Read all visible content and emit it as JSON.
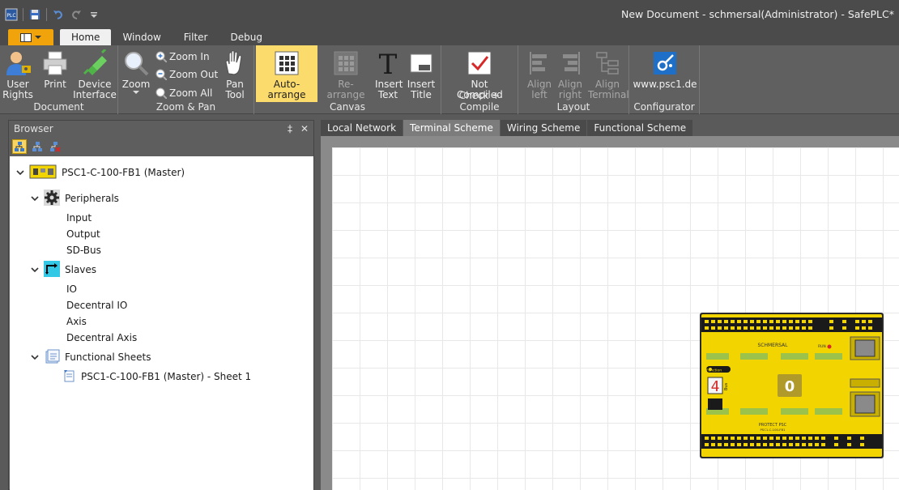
{
  "window": {
    "title": "New Document - schmersal(Administrator) - SafePLC*"
  },
  "quick_access": {
    "icons": [
      "app-logo-icon",
      "save-icon",
      "undo-icon",
      "redo-icon",
      "dropdown-icon"
    ]
  },
  "ribbon_tabs": [
    {
      "label": "Home"
    },
    {
      "label": "Window"
    },
    {
      "label": "Filter"
    },
    {
      "label": "Debug"
    }
  ],
  "ribbon": {
    "groups": {
      "document": "Document",
      "zoom_pan": "Zoom & Pan",
      "canvas": "Canvas",
      "check": "Check + Compile",
      "layout": "Layout",
      "configurator": "Configurator"
    },
    "buttons": {
      "user_rights": "User Rights",
      "print": "Print",
      "device_interface": "Device Interface",
      "zoom": "Zoom",
      "zoom_in": "Zoom In",
      "zoom_out": "Zoom Out",
      "zoom_all": "Zoom All",
      "pan_tool": "Pan Tool",
      "auto_arrange": "Auto-arrange",
      "re_arrange": "Re-arrange",
      "insert_text": "Insert Text",
      "insert_title": "Insert Title",
      "not_compiled": "Not Compiled",
      "align_left": "Align left",
      "align_right": "Align right",
      "align_terminal": "Align Terminal",
      "website": "www.psc1.de"
    }
  },
  "browser": {
    "title": "Browser",
    "pin": "‡",
    "close": "✕",
    "tree": {
      "root": "PSC1-C-100-FB1 (Master)",
      "peripherals": {
        "label": "Peripherals",
        "items": [
          "Input",
          "Output",
          "SD-Bus"
        ]
      },
      "slaves": {
        "label": "Slaves",
        "items": [
          "IO",
          "Decentral IO",
          "Axis",
          "Decentral Axis"
        ]
      },
      "functional_sheets": {
        "label": "Functional Sheets",
        "items": [
          "PSC1-C-100-FB1 (Master) - Sheet 1"
        ]
      }
    }
  },
  "doc_tabs": [
    {
      "label": "Local Network"
    },
    {
      "label": "Terminal Scheme"
    },
    {
      "label": "Wiring Scheme"
    },
    {
      "label": "Functional Scheme"
    }
  ],
  "device": {
    "brand": "SCHMERSAL",
    "function_label": "Function",
    "bus_label": "Bus",
    "display_value": "4",
    "counter_value": "0",
    "product_name": "PROTECT PSC",
    "product_code": "PSC1-C-100-FB1",
    "run_label": "RUN",
    "colors": {
      "body": "#f2d500",
      "dark": "#1a1a1a"
    }
  }
}
